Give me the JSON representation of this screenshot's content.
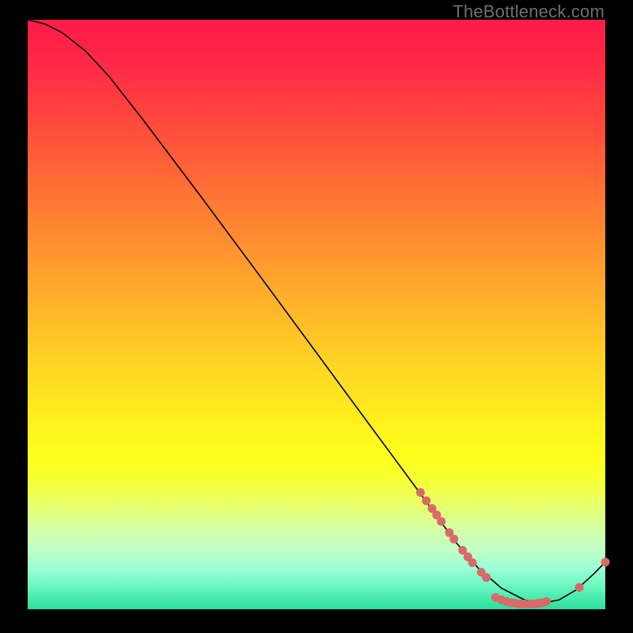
{
  "watermark": "TheBottleneck.com",
  "colors": {
    "dot": "#d86a6a",
    "curve": "#000000",
    "frame_bg": "#000000"
  },
  "chart_data": {
    "type": "line",
    "title": "",
    "xlabel": "",
    "ylabel": "",
    "xlim": [
      0,
      100
    ],
    "ylim": [
      0,
      100
    ],
    "curve": [
      {
        "x": 0.0,
        "y": 100.0
      },
      {
        "x": 3.0,
        "y": 99.3
      },
      {
        "x": 6.0,
        "y": 97.8
      },
      {
        "x": 10.0,
        "y": 94.7
      },
      {
        "x": 14.0,
        "y": 90.5
      },
      {
        "x": 20.0,
        "y": 83.0
      },
      {
        "x": 30.0,
        "y": 70.0
      },
      {
        "x": 40.0,
        "y": 56.8
      },
      {
        "x": 50.0,
        "y": 43.5
      },
      {
        "x": 60.0,
        "y": 30.2
      },
      {
        "x": 68.0,
        "y": 19.6
      },
      {
        "x": 74.0,
        "y": 11.5
      },
      {
        "x": 78.0,
        "y": 7.0
      },
      {
        "x": 82.0,
        "y": 3.6
      },
      {
        "x": 86.0,
        "y": 1.6
      },
      {
        "x": 89.0,
        "y": 1.0
      },
      {
        "x": 92.0,
        "y": 1.6
      },
      {
        "x": 95.0,
        "y": 3.3
      },
      {
        "x": 98.0,
        "y": 6.0
      },
      {
        "x": 100.0,
        "y": 8.0
      }
    ],
    "scatter": [
      {
        "x": 68.0,
        "y": 19.8
      },
      {
        "x": 69.0,
        "y": 18.4
      },
      {
        "x": 70.0,
        "y": 17.1
      },
      {
        "x": 70.8,
        "y": 16.0
      },
      {
        "x": 71.6,
        "y": 14.9
      },
      {
        "x": 73.0,
        "y": 13.0
      },
      {
        "x": 73.8,
        "y": 11.9
      },
      {
        "x": 75.3,
        "y": 10.0
      },
      {
        "x": 76.2,
        "y": 8.9
      },
      {
        "x": 77.0,
        "y": 7.9
      },
      {
        "x": 78.5,
        "y": 6.3
      },
      {
        "x": 79.4,
        "y": 5.4
      },
      {
        "x": 81.0,
        "y": 2.0
      },
      {
        "x": 82.0,
        "y": 1.6
      },
      {
        "x": 82.9,
        "y": 1.3
      },
      {
        "x": 83.7,
        "y": 1.1
      },
      {
        "x": 84.5,
        "y": 1.0
      },
      {
        "x": 85.3,
        "y": 0.9
      },
      {
        "x": 86.1,
        "y": 0.9
      },
      {
        "x": 86.9,
        "y": 0.9
      },
      {
        "x": 87.7,
        "y": 0.9
      },
      {
        "x": 88.4,
        "y": 1.0
      },
      {
        "x": 89.1,
        "y": 1.1
      },
      {
        "x": 89.8,
        "y": 1.3
      },
      {
        "x": 95.5,
        "y": 3.7
      },
      {
        "x": 100.0,
        "y": 8.0
      }
    ],
    "dot_radius_px": 5.5
  }
}
